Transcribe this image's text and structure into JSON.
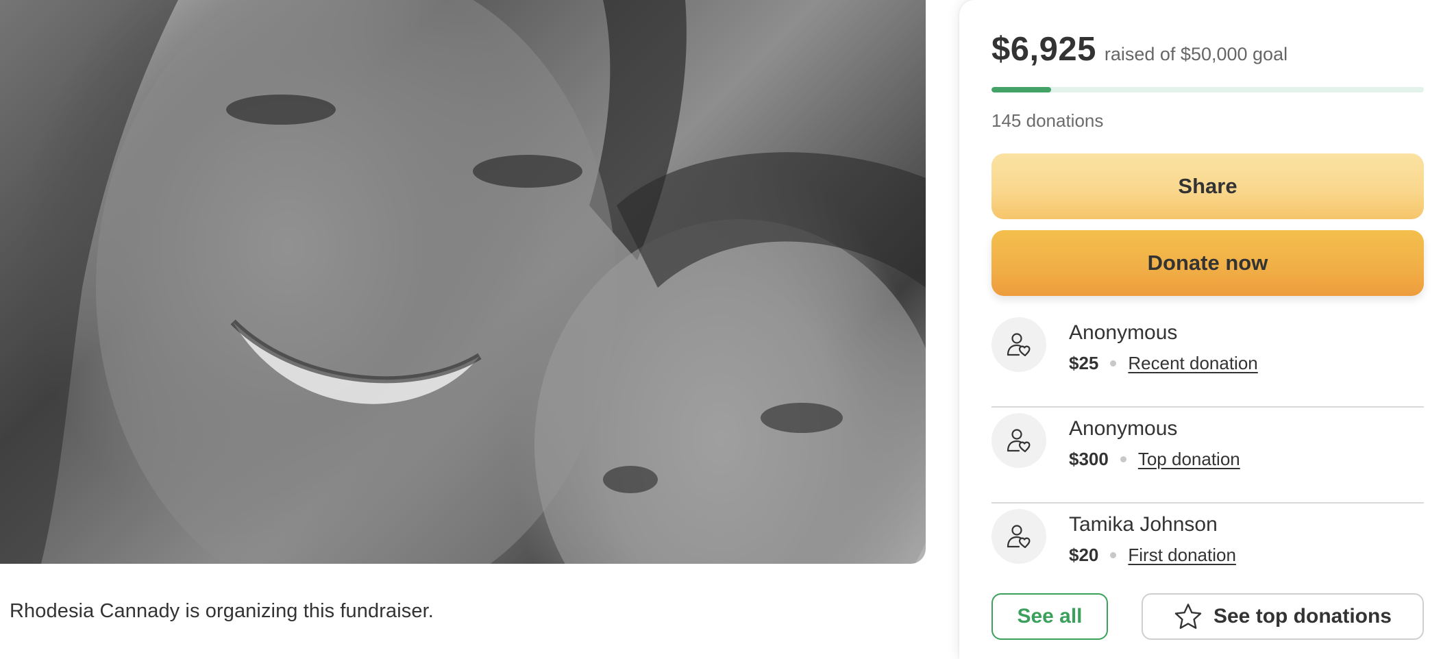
{
  "photo": {
    "alt": "Organizer photo",
    "style": "grayscale"
  },
  "organizer": {
    "text": "Rhodesia Cannady is organizing this fundraiser."
  },
  "campaign": {
    "raised": "$6,925",
    "goal_text": "raised of $50,000 goal",
    "progress_fraction": 0.1385,
    "donation_count": "145 donations",
    "accent_color": "#43a366",
    "progress_track_color": "#e3f3ec"
  },
  "buttons": {
    "share": "Share",
    "donate": "Donate now",
    "see_all": "See all",
    "see_top": "See top donations"
  },
  "donations": [
    {
      "name": "Anonymous",
      "amount": "$25",
      "tag": "Recent donation",
      "icon": "donor-heart-icon"
    },
    {
      "name": "Anonymous",
      "amount": "$300",
      "tag": "Top donation",
      "icon": "donor-heart-icon"
    },
    {
      "name": "Tamika Johnson",
      "amount": "$20",
      "tag": "First donation",
      "icon": "donor-heart-icon"
    }
  ],
  "icons": {
    "see_top": "star-icon"
  }
}
